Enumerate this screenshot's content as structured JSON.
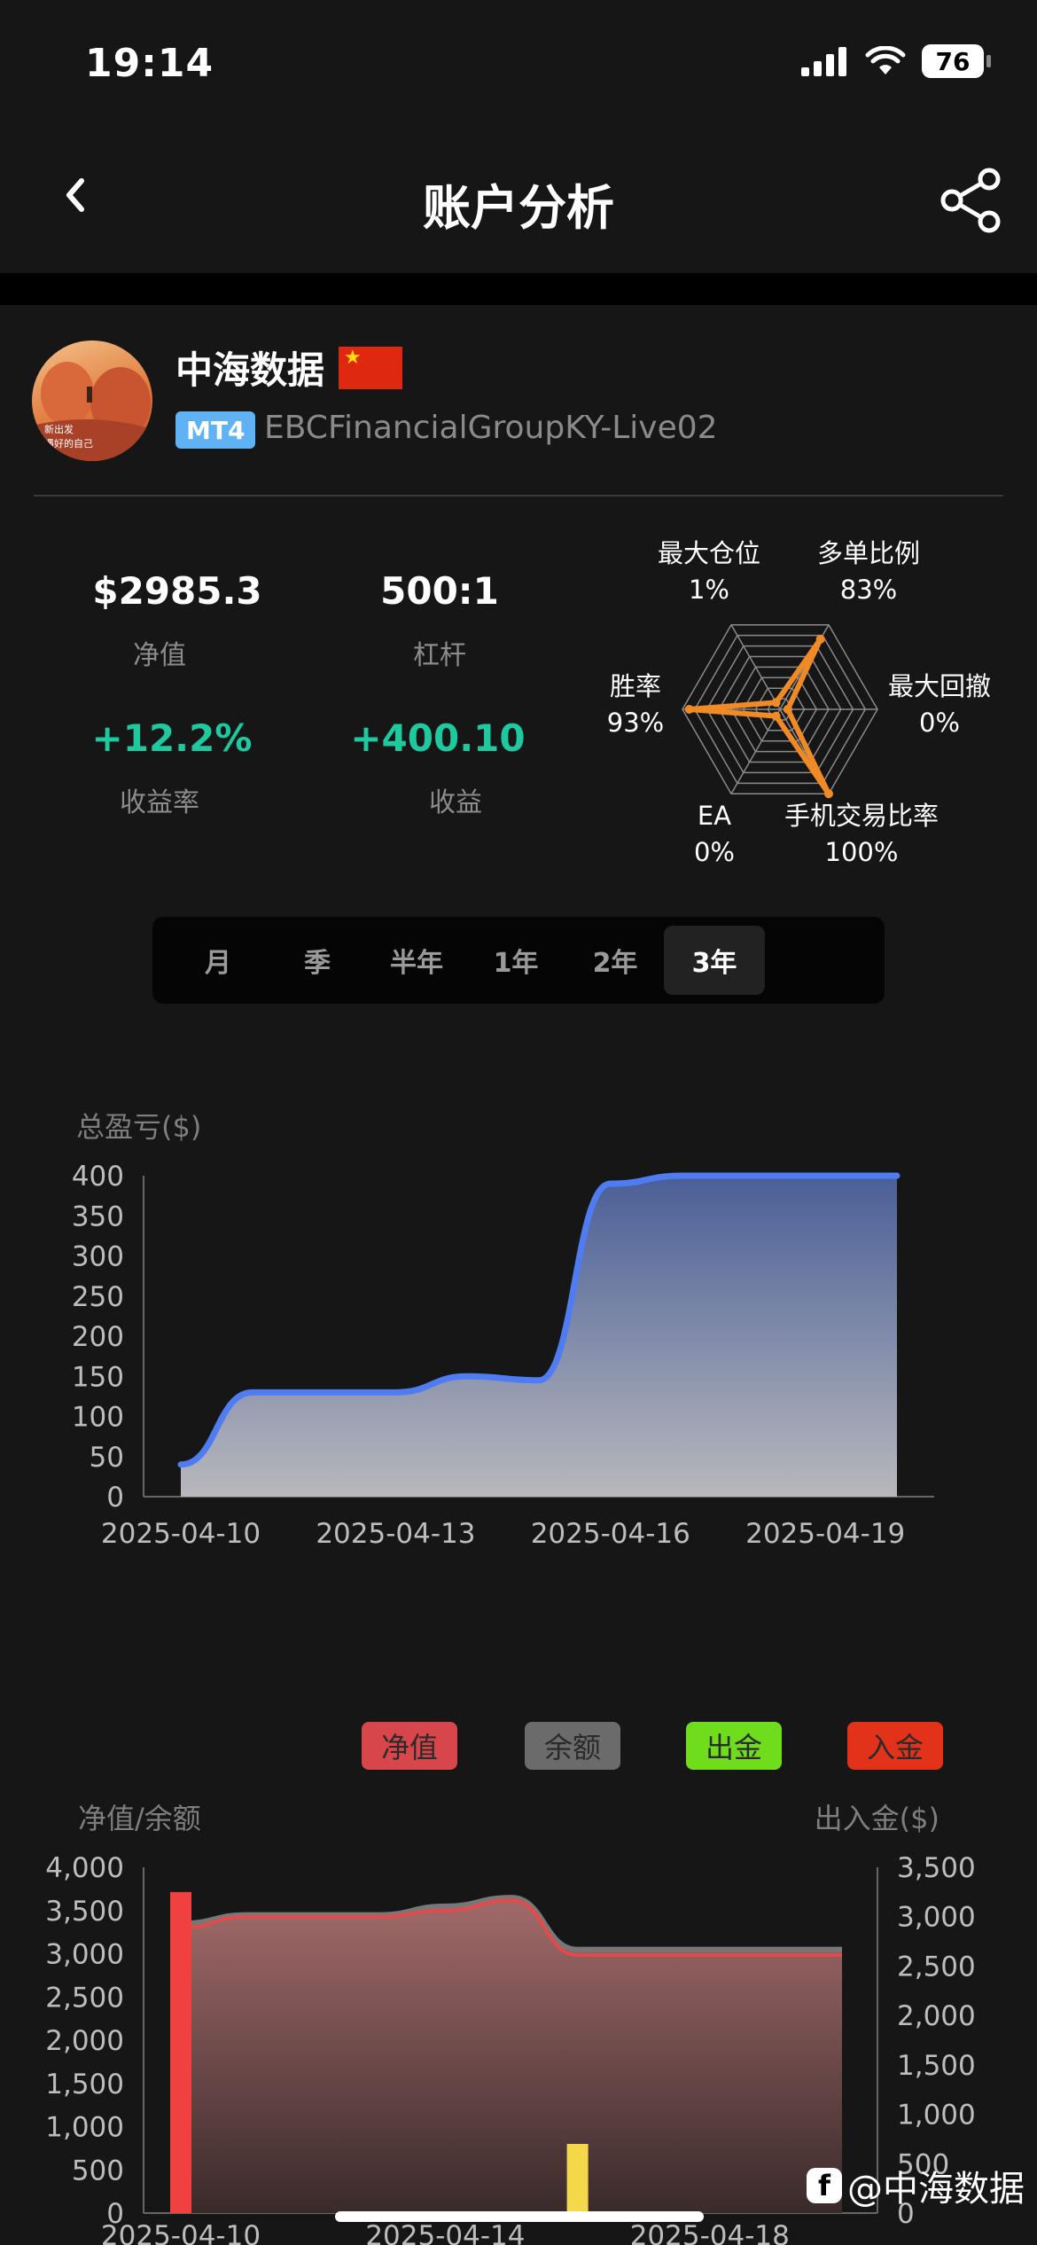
{
  "status": {
    "time": "19:14",
    "battery": "76"
  },
  "nav": {
    "title": "账户分析"
  },
  "profile": {
    "name": "中海数据",
    "platform": "MT4",
    "account": "EBCFinancialGroupKY-Live02",
    "avatar_text_1": "新出发",
    "avatar_text_2": "遇好的自己"
  },
  "stats": {
    "equity_value": "$2985.3",
    "equity_label": "净值",
    "leverage_value": "500:1",
    "leverage_label": "杠杆",
    "return_rate_value": "+12.2%",
    "return_rate_label": "收益率",
    "profit_value": "+400.10",
    "profit_label": "收益"
  },
  "radar": {
    "axes": [
      {
        "label": "最大仓位",
        "value": "1%",
        "fraction": 0.01
      },
      {
        "label": "多单比例",
        "value": "83%",
        "fraction": 0.83
      },
      {
        "label": "最大回撤",
        "value": "0%",
        "fraction": 0.0
      },
      {
        "label": "手机交易比率",
        "value": "100%",
        "fraction": 1.0
      },
      {
        "label": "EA",
        "value": "0%",
        "fraction": 0.0
      },
      {
        "label": "胜率",
        "value": "93%",
        "fraction": 0.93
      }
    ],
    "color": "#f08a24"
  },
  "tabs": [
    {
      "label": "月",
      "active": false
    },
    {
      "label": "季",
      "active": false
    },
    {
      "label": "半年",
      "active": false
    },
    {
      "label": "1年",
      "active": false
    },
    {
      "label": "2年",
      "active": false
    },
    {
      "label": "3年",
      "active": true
    }
  ],
  "chart_data": [
    {
      "type": "area",
      "title": "",
      "ylabel": "总盈亏($)",
      "ylim": [
        0,
        400
      ],
      "y_ticks": [
        "0",
        "50",
        "100",
        "150",
        "200",
        "250",
        "300",
        "350",
        "400"
      ],
      "x_ticks": [
        "2025-04-10",
        "2025-04-13",
        "2025-04-16",
        "2025-04-19"
      ],
      "x": [
        "2025-04-10",
        "2025-04-11",
        "2025-04-12",
        "2025-04-13",
        "2025-04-14",
        "2025-04-15",
        "2025-04-16",
        "2025-04-17",
        "2025-04-18",
        "2025-04-19",
        "2025-04-20"
      ],
      "series": [
        {
          "values": [
            40,
            130,
            130,
            130,
            150,
            145,
            390,
            400,
            400,
            400,
            400
          ]
        }
      ],
      "colors": {
        "line": "#4f7cf2",
        "fill_top": "#4a5f98",
        "fill_bottom": "#b8b8bc"
      }
    },
    {
      "type": "area",
      "legend": [
        {
          "label": "净值",
          "bg": "#d6464b",
          "fg": "#2a2a2a"
        },
        {
          "label": "余额",
          "bg": "#6b6b6b",
          "fg": "#2a2a2a"
        },
        {
          "label": "出金",
          "bg": "#6fdc1c",
          "fg": "#2a2a2a"
        },
        {
          "label": "入金",
          "bg": "#e2331a",
          "fg": "#2a2a2a"
        }
      ],
      "ylabel_left": "净值/余额",
      "ylabel_right": "出入金($)",
      "ylim_left": [
        0,
        4000
      ],
      "ylim_right": [
        0,
        3500
      ],
      "y_ticks_left": [
        "0",
        "500",
        "1,000",
        "1,500",
        "2,000",
        "2,500",
        "3,000",
        "3,500",
        "4,000"
      ],
      "y_ticks_right": [
        "0",
        "500",
        "1,000",
        "1,500",
        "2,000",
        "2,500",
        "3,000",
        "3,500"
      ],
      "x_ticks": [
        "2025-04-10",
        "2025-04-14",
        "2025-04-18"
      ],
      "x": [
        "2025-04-10",
        "2025-04-11",
        "2025-04-12",
        "2025-04-13",
        "2025-04-14",
        "2025-04-15",
        "2025-04-16",
        "2025-04-17",
        "2025-04-18",
        "2025-04-19",
        "2025-04-20"
      ],
      "series": [
        {
          "name": "余额",
          "values": [
            3350,
            3450,
            3450,
            3450,
            3550,
            3650,
            3050,
            3050,
            3050,
            3050,
            3050
          ]
        },
        {
          "name": "净值",
          "values": [
            3300,
            3430,
            3430,
            3430,
            3500,
            3620,
            2985,
            2985,
            2985,
            2985,
            2985
          ]
        }
      ],
      "bars": [
        {
          "name": "入金",
          "x": "2025-04-10",
          "value": 3250,
          "color": "#f04040"
        },
        {
          "name": "出金",
          "x": "2025-04-16",
          "value": 700,
          "color": "#f5d84a"
        }
      ]
    }
  ],
  "watermark": "@中海数据"
}
